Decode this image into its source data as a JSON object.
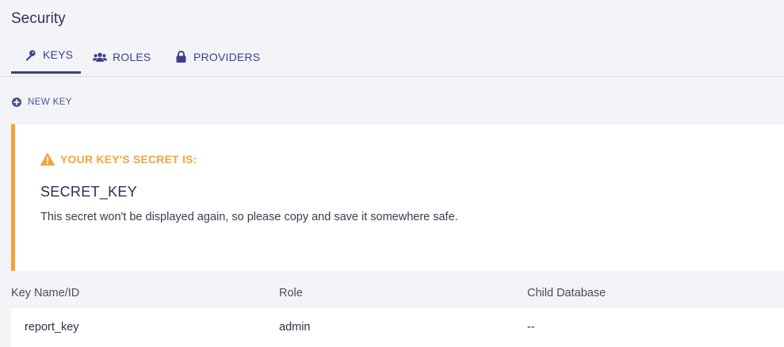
{
  "page": {
    "title": "Security"
  },
  "tabs": [
    {
      "label": "KEYS",
      "icon": "key-icon",
      "active": true
    },
    {
      "label": "ROLES",
      "icon": "users-icon",
      "active": false
    },
    {
      "label": "PROVIDERS",
      "icon": "lock-icon",
      "active": false
    }
  ],
  "actions": {
    "new_key_label": "NEW KEY",
    "new_key_icon": "plus-circle-icon"
  },
  "alert": {
    "heading": "YOUR KEY'S SECRET IS:",
    "icon": "warning-icon",
    "secret": "SECRET_KEY",
    "message": "This secret won't be displayed again, so please copy and save it somewhere safe.",
    "accent_color": "#f1a43c"
  },
  "table": {
    "headers": [
      "Key Name/ID",
      "Role",
      "Child Database"
    ],
    "rows": [
      [
        "report_key",
        "admin",
        "--"
      ]
    ]
  },
  "colors": {
    "brand": "#3c3f8f",
    "background": "#f3f4f8"
  }
}
